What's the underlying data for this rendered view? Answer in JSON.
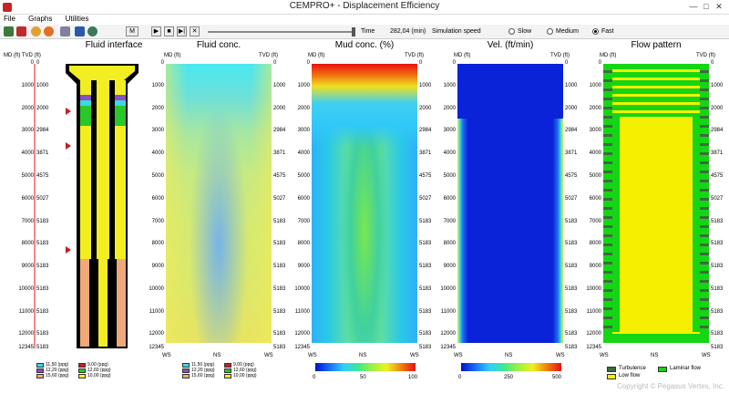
{
  "window": {
    "title": "CEMPRO+ - Displacement Efficiency",
    "controls": [
      "—",
      "□",
      "✕"
    ]
  },
  "menu": [
    "File",
    "Graphs",
    "Utilities"
  ],
  "toolbar": {
    "time_label": "Time",
    "time_value": "282,04 (min)",
    "speed_label": "Simulation speed",
    "speed_options": [
      "Slow",
      "Medium",
      "Fast"
    ],
    "speed_selected": "Fast",
    "playback_buttons": [
      "M",
      "▶",
      "■",
      "▶|",
      "✕"
    ],
    "slider_fraction": 0.99
  },
  "panels": {
    "fluid_interface": "Fluid interface",
    "fluid_conc": "Fluid conc.",
    "mud_conc": "Mud conc. (%)",
    "vel": "Vel. (ft/min)",
    "flow_pattern": "Flow pattern"
  },
  "axis": {
    "md_tvd": "MD (ft) TVD (ft)",
    "md": "MD (ft)",
    "tvd": "TVD (ft)",
    "md_ticks": [
      "0",
      "1000",
      "2000",
      "3000",
      "4000",
      "5000",
      "6000",
      "7000",
      "8000",
      "9000",
      "10000",
      "11000",
      "12000",
      "12345"
    ],
    "tvd_ticks": [
      "0",
      "1000",
      "2000",
      "2984",
      "3871",
      "4575",
      "5027",
      "5183",
      "5183",
      "5183",
      "5183",
      "5183",
      "5183",
      "5183"
    ],
    "bottom": [
      "WS",
      "NS",
      "WS"
    ]
  },
  "fluid_legend": [
    {
      "label": "11,50 (ppg)",
      "color": "#3fd6e6"
    },
    {
      "label": "9,00 (ppg)",
      "color": "#c82020"
    },
    {
      "label": "12,20 (ppg)",
      "color": "#8a4fc2"
    },
    {
      "label": "12,60 (ppg)",
      "color": "#28c828"
    },
    {
      "label": "15,60 (ppg)",
      "color": "#f0a878"
    },
    {
      "label": "10,00 (ppg)",
      "color": "#f2ee22"
    }
  ],
  "mud_colorbar": [
    "0",
    "50",
    "100"
  ],
  "vel_colorbar": [
    "0",
    "250",
    "500"
  ],
  "flow_legend": [
    {
      "label": "Turbulence",
      "color": "#3d6b3d"
    },
    {
      "label": "Laminar flow",
      "color": "#14d614"
    },
    {
      "label": "Low flow",
      "color": "#f4f000"
    }
  ],
  "copyright": "Copyright © Pegasus Vertex, Inc.",
  "colors": {
    "cyan": "#3fd6e6",
    "yellow": "#f2ee22",
    "green": "#28c828",
    "blue": "#0a22d8",
    "red": "#e81010"
  }
}
